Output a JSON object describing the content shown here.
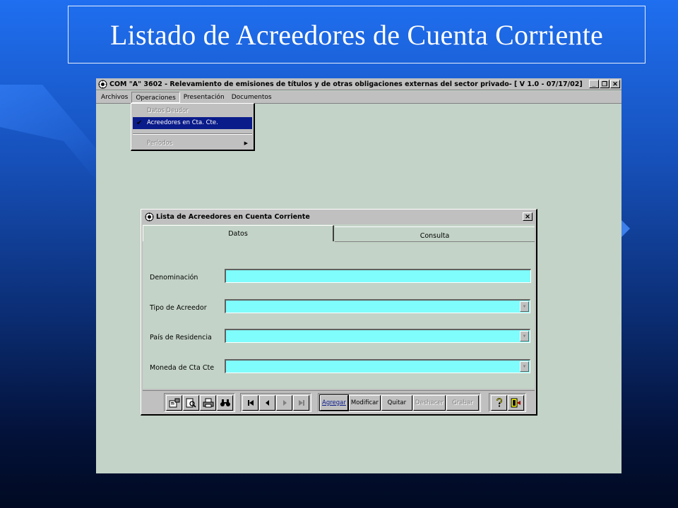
{
  "slide": {
    "title": "Listado de Acreedores de Cuenta Corriente"
  },
  "app": {
    "title": "COM \"A\" 3602 - Relevamiento de emisiones de títulos y de otras obligaciones externas del sector privado- [ V 1.0 - 07/17/02]",
    "window_buttons": {
      "minimize": "_",
      "restore": "❐",
      "close": "✕"
    },
    "menu": [
      "Archivos",
      "Operaciones",
      "Presentación",
      "Documentos"
    ],
    "open_menu": "Operaciones",
    "dropdown": {
      "items": [
        "Datos Deudor",
        "Acreedores en Cta. Cte."
      ],
      "selected": "Acreedores en Cta. Cte.",
      "submenu_item": "Períodos"
    }
  },
  "dialog": {
    "title": "Lista de Acreedores en Cuenta Corriente",
    "close": "✕",
    "tabs": [
      "Datos",
      "Consulta"
    ],
    "active_tab": "Datos",
    "fields": [
      {
        "label": "Denominación",
        "value": ""
      },
      {
        "label": "Tipo de Acreedor",
        "value": ""
      },
      {
        "label": "País de Residencia",
        "value": ""
      },
      {
        "label": "Moneda de Cta Cte",
        "value": ""
      }
    ],
    "toolbar": {
      "buttons": [
        "Agregar",
        "Modificar",
        "Quitar",
        "Deshacer",
        "Grabar"
      ],
      "disabled": [
        "Deshacer",
        "Grabar"
      ],
      "default": "Agregar",
      "icons": [
        "properties-icon",
        "print-preview-icon",
        "print-icon",
        "find-icon",
        "first-record-icon",
        "previous-record-icon",
        "next-record-icon",
        "last-record-icon",
        "help-icon",
        "exit-icon"
      ]
    }
  },
  "colors": {
    "slide_background": "#1752bd",
    "app_background": "#c3d3c7",
    "input_background": "#7ffcfc",
    "menu_highlight": "#0a1b8a"
  }
}
